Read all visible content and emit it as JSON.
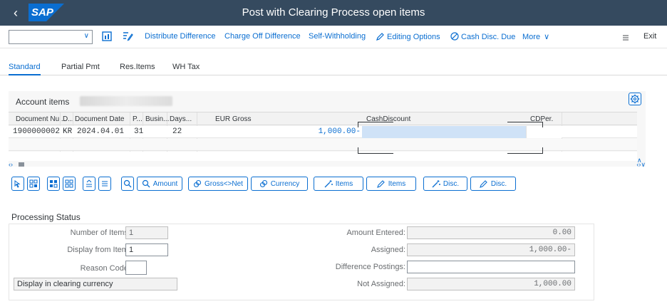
{
  "shell": {
    "title": "Post with Clearing Process open items",
    "back_glyph": "‹",
    "logo_text": "SAP",
    "logo_color": "#0a6ed1",
    "bar_color": "#354a5f"
  },
  "toolbar": {
    "select_value": "",
    "distribute_difference": "Distribute Difference",
    "charge_off_difference": "Charge Off Difference",
    "self_withholding": "Self-Withholding",
    "editing_options": "Editing Options",
    "cash_disc_due": "Cash Disc. Due",
    "more": "More",
    "exit": "Exit",
    "icons": [
      "chart-icon",
      "edit-document-icon",
      "pencil-icon",
      "cancel-circle-icon",
      "chevron-down-icon",
      "align-icon"
    ]
  },
  "tabs": [
    {
      "label": "Standard",
      "active": true
    },
    {
      "label": "Partial Pmt",
      "active": false
    },
    {
      "label": "Res.Items",
      "active": false
    },
    {
      "label": "WH Tax",
      "active": false
    }
  ],
  "account_items": {
    "title": "Account items",
    "columns": [
      "Document Nu...",
      "D...",
      "Document Date",
      "P...",
      "Busin...",
      "Days...",
      "EUR Gross",
      "CashDiscount",
      "CDPer."
    ],
    "rows": [
      {
        "doc_no": "1900000002",
        "doc_type": "KR",
        "doc_date": "2024.04.01",
        "posting_key": "31",
        "business_area": "",
        "days": "22",
        "gross": "1,000.00-",
        "cash_discount": "",
        "cd_percent": ""
      }
    ]
  },
  "buttons": {
    "amount": "Amount",
    "gross_net": "Gross<>Net",
    "currency": "Currency",
    "items_activate": "Items",
    "items_edit": "Items",
    "disc_activate": "Disc.",
    "disc_edit": "Disc."
  },
  "processing_status": {
    "title": "Processing Status",
    "number_of_items_label": "Number of Items:",
    "number_of_items": "1",
    "display_from_item_label": "Display from Item:",
    "display_from_item": "1",
    "reason_code_label": "Reason Code:",
    "reason_code": "",
    "display_clearing_currency": "Display in clearing currency",
    "amount_entered_label": "Amount Entered:",
    "amount_entered": "0.00",
    "assigned_label": "Assigned:",
    "assigned": "1,000.00-",
    "difference_postings_label": "Difference Postings:",
    "difference_postings": "",
    "not_assigned_label": "Not Assigned:",
    "not_assigned": "1,000.00"
  }
}
